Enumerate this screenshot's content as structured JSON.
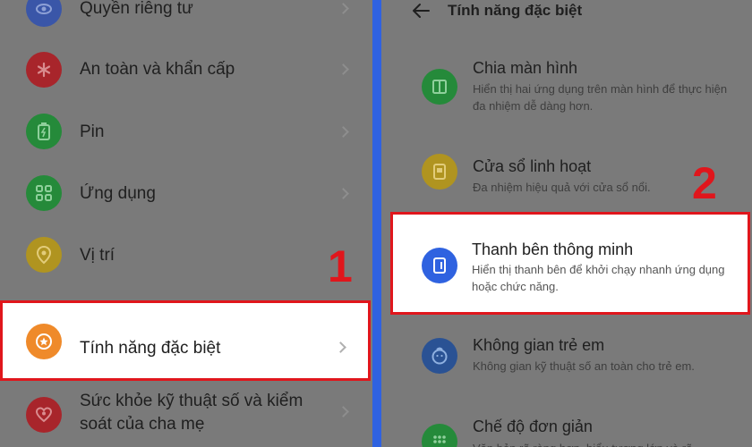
{
  "left": {
    "items": [
      {
        "label": "Quyền riêng tư",
        "icon": "eye-shield-icon",
        "color": "#3a56a8"
      },
      {
        "label": "An toàn và khẩn cấp",
        "icon": "asterisk-icon",
        "color": "#a8252b"
      },
      {
        "label": "Pin",
        "icon": "battery-icon",
        "color": "#258a3a"
      },
      {
        "label": "Ứng dụng",
        "icon": "apps-grid-icon",
        "color": "#258a3a"
      },
      {
        "label": "Vị trí",
        "icon": "location-pin-icon",
        "color": "#b09420"
      },
      {
        "label": "Tính năng đặc biệt",
        "icon": "star-circle-icon",
        "color": "#ef8a2a"
      },
      {
        "label": "Sức khỏe kỹ thuật số và kiểm soát của cha mẹ",
        "icon": "heart-person-icon",
        "color": "#a8252b"
      }
    ]
  },
  "right": {
    "title": "Tính năng đặc biệt",
    "items": [
      {
        "title": "Chia màn hình",
        "desc": "Hiển thị hai ứng dụng trên màn hình để thực hiện đa nhiệm dễ dàng hơn.",
        "icon": "split-screen-icon",
        "color": "#258a3a"
      },
      {
        "title": "Cửa sổ linh hoạt",
        "desc": "Đa nhiệm hiệu quả với cửa sổ nổi.",
        "icon": "floating-window-icon",
        "color": "#b09420"
      },
      {
        "title": "Thanh bên thông minh",
        "desc": "Hiển thị thanh bên để khởi chạy nhanh ứng dụng hoặc chức năng.",
        "icon": "sidebar-icon",
        "color": "#2f62e0"
      },
      {
        "title": "Không gian trẻ em",
        "desc": "Không gian kỹ thuật số an toàn cho trẻ em.",
        "icon": "kid-face-icon",
        "color": "#2a5294"
      },
      {
        "title": "Chế độ đơn giản",
        "desc": "Văn bản rõ ràng hơn, biểu tượng lớn và rõ",
        "icon": "simple-grid-icon",
        "color": "#258a3a"
      }
    ]
  },
  "annotations": {
    "step1": "1",
    "step2": "2"
  },
  "colors": {
    "highlight_border": "#e0161c",
    "divider": "#2f62e0",
    "dim_bg": "#7a7a7a"
  }
}
